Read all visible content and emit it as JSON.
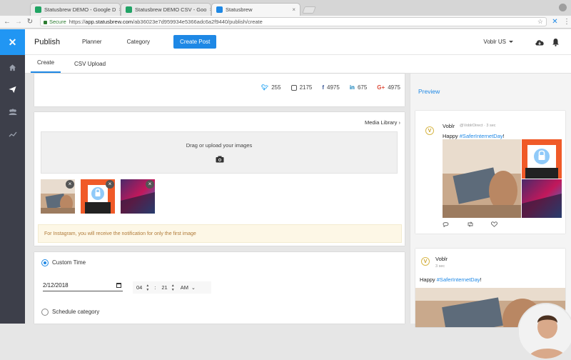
{
  "browser": {
    "tabs": [
      {
        "title": "Statusbrew DEMO - Google D",
        "favicon": "#1fa463"
      },
      {
        "title": "Statusbrew DEMO CSV - Goo",
        "favicon": "#21a366"
      },
      {
        "title": "Statusbrew",
        "favicon": "#1e88e5"
      }
    ],
    "secure_label": "Secure",
    "url_scheme": "https://",
    "url_host": "app.statusbrew.com",
    "url_path": "/ab36023e7d959934e5366adc6a2f9440/publish/create"
  },
  "sidebar": {
    "logo_icon": "statusbrew-logo-icon",
    "items": [
      {
        "icon": "home-icon"
      },
      {
        "icon": "send-icon"
      },
      {
        "icon": "users-icon"
      },
      {
        "icon": "analytics-icon"
      }
    ]
  },
  "header": {
    "title": "Publish",
    "nav": [
      "Planner",
      "Category"
    ],
    "create_post": "Create Post",
    "account": "Voblr US"
  },
  "subtabs": [
    {
      "label": "Create"
    },
    {
      "label": "CSV Upload"
    }
  ],
  "counts": [
    {
      "network": "twitter",
      "value": "255"
    },
    {
      "network": "instagram",
      "value": "2175"
    },
    {
      "network": "facebook",
      "value": "4975"
    },
    {
      "network": "linkedin",
      "value": "675"
    },
    {
      "network": "google-plus",
      "value": "4975"
    }
  ],
  "media": {
    "library_label": "Media Library ›",
    "dropzone_text": "Drag or upload your images",
    "thumb_remove": "×",
    "notice": "For Instagram, you will receive the notification for only the first image"
  },
  "schedule": {
    "custom_time_label": "Custom Time",
    "date": "2/12/2018",
    "hour": "04",
    "separator": ":",
    "minute": "21",
    "ampm": "AM",
    "category_label": "Schedule category"
  },
  "preview": {
    "title": "Preview",
    "post1": {
      "avatar": "V",
      "name": "Voblr",
      "handle": "@VoblrDirect · 3 sec",
      "text_prefix": "Happy ",
      "hashtag": "#SaferInternetDay",
      "text_suffix": "!"
    },
    "post2": {
      "avatar": "V",
      "name": "Voblr",
      "time": "3 sec",
      "text_prefix": "Happy ",
      "hashtag": "#SaferInternetDay",
      "text_suffix": "!"
    }
  },
  "colors": {
    "accent": "#1e88e5",
    "sidebar": "#3d3f4a",
    "notice_text": "#b07a38"
  }
}
